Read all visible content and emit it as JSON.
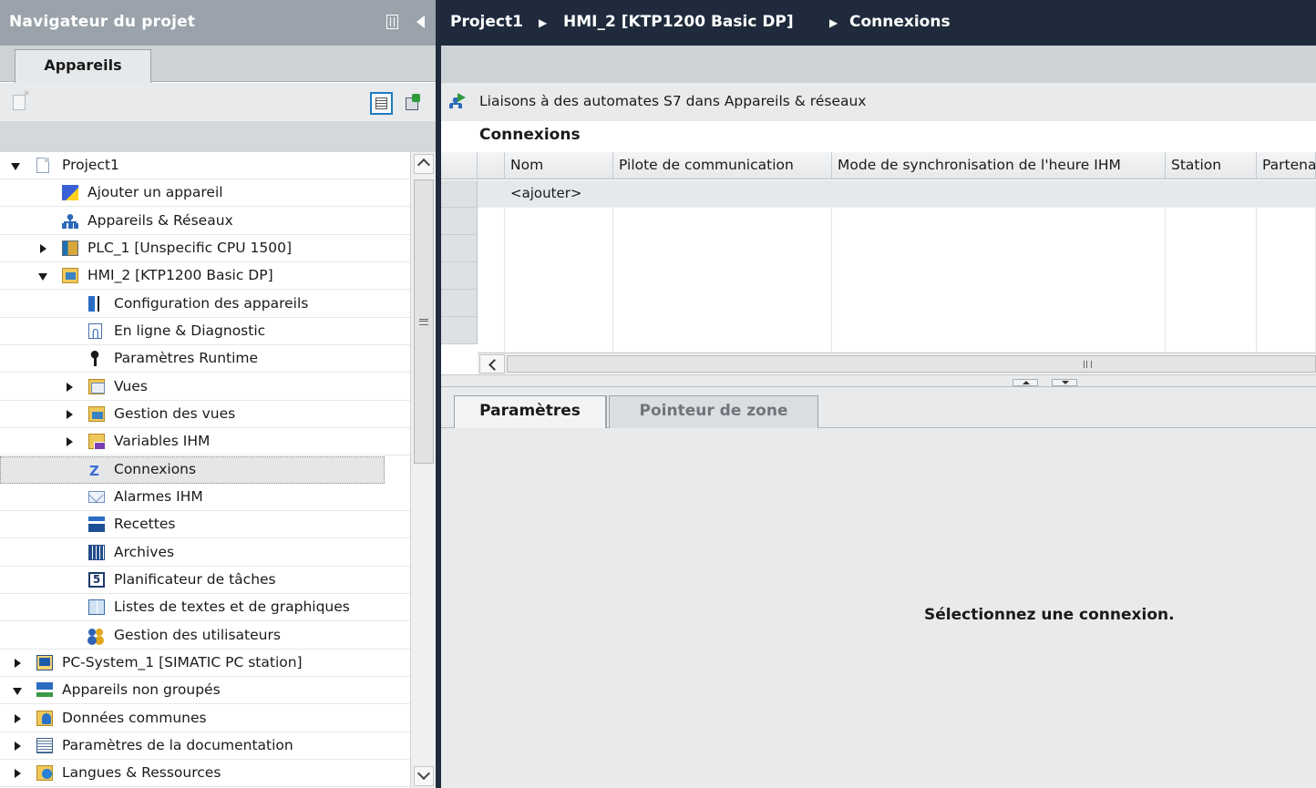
{
  "navigator": {
    "title": "Navigateur du projet",
    "tab": "Appareils",
    "tree": [
      {
        "label": "Project1",
        "icon": "project-icon",
        "state": "expanded",
        "level": 0
      },
      {
        "label": "Ajouter un appareil",
        "icon": "add-device-icon",
        "state": "none",
        "level": 1
      },
      {
        "label": "Appareils & Réseaux",
        "icon": "network-icon",
        "state": "none",
        "level": 1
      },
      {
        "label": "PLC_1 [Unspecific CPU 1500]",
        "icon": "plc-icon",
        "state": "collapsed",
        "level": 1
      },
      {
        "label": "HMI_2 [KTP1200 Basic DP]",
        "icon": "hmi-icon",
        "state": "expanded",
        "level": 1
      },
      {
        "label": "Configuration des appareils",
        "icon": "device-config-icon",
        "state": "none",
        "level": 2
      },
      {
        "label": "En ligne & Diagnostic",
        "icon": "online-diagnostic-icon",
        "state": "none",
        "level": 2
      },
      {
        "label": "Paramètres Runtime",
        "icon": "runtime-settings-icon",
        "state": "none",
        "level": 2
      },
      {
        "label": "Vues",
        "icon": "screens-folder-icon",
        "state": "collapsed",
        "level": 2
      },
      {
        "label": "Gestion des vues",
        "icon": "screen-management-icon",
        "state": "collapsed",
        "level": 2
      },
      {
        "label": "Variables IHM",
        "icon": "hmi-tags-icon",
        "state": "collapsed",
        "level": 2
      },
      {
        "label": "Connexions",
        "icon": "connections-icon",
        "state": "none",
        "level": 2,
        "selected": true
      },
      {
        "label": "Alarmes IHM",
        "icon": "alarms-icon",
        "state": "none",
        "level": 2
      },
      {
        "label": "Recettes",
        "icon": "recipes-icon",
        "state": "none",
        "level": 2
      },
      {
        "label": "Archives",
        "icon": "archives-icon",
        "state": "none",
        "level": 2
      },
      {
        "label": "Planificateur de tâches",
        "icon": "scheduler-icon",
        "state": "none",
        "level": 2
      },
      {
        "label": "Listes de textes et de graphiques",
        "icon": "text-graphic-lists-icon",
        "state": "none",
        "level": 2
      },
      {
        "label": "Gestion des utilisateurs",
        "icon": "user-admin-icon",
        "state": "none",
        "level": 2
      },
      {
        "label": "PC-System_1 [SIMATIC PC station]",
        "icon": "pc-station-icon",
        "state": "collapsed",
        "level": 1
      },
      {
        "label": "Appareils non groupés",
        "icon": "ungrouped-devices-icon",
        "state": "expanded",
        "level": 1
      },
      {
        "label": "Données communes",
        "icon": "common-data-icon",
        "state": "collapsed",
        "level": 1
      },
      {
        "label": "Paramètres de la documentation",
        "icon": "documentation-icon",
        "state": "collapsed",
        "level": 1
      },
      {
        "label": "Langues & Ressources",
        "icon": "languages-icon",
        "state": "collapsed",
        "level": 1
      }
    ]
  },
  "breadcrumb": {
    "items": [
      "Project1",
      "HMI_2 [KTP1200 Basic DP]",
      "Connexions"
    ],
    "separator": "▶"
  },
  "editor": {
    "link_text": "Liaisons à des automates S7 dans Appareils & réseaux",
    "section_title": "Connexions",
    "columns": [
      "Nom",
      "Pilote de communication",
      "Mode de synchronisation de l'heure IHM",
      "Station",
      "Partenaire"
    ],
    "add_row": "<ajouter>",
    "tabs": [
      "Paramètres",
      "Pointeur de zone"
    ],
    "active_tab": "Paramètres",
    "empty_message": "Sélectionnez une connexion."
  },
  "colors": {
    "navigator_title_bg": "#9aa3ab",
    "editor_title_bg": "#1f2b3c",
    "panel_bg": "#e8eaec",
    "selection_bg": "#e4e6e8"
  }
}
